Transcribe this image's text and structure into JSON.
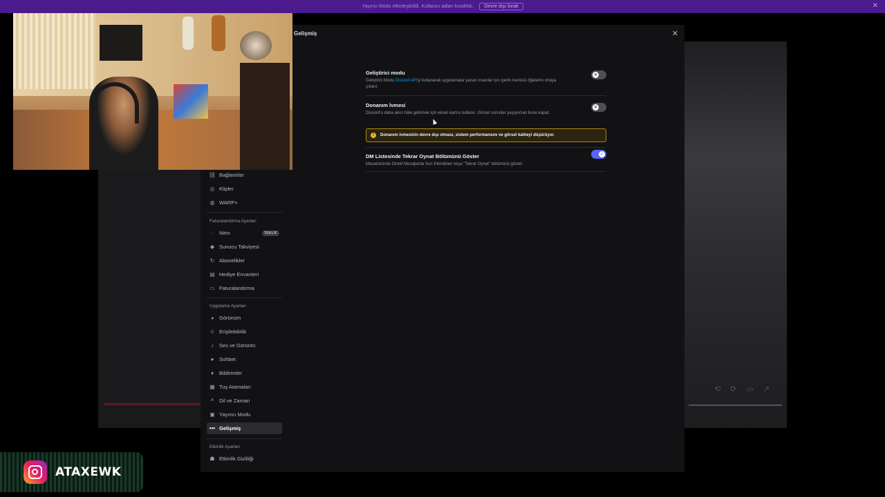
{
  "banner": {
    "text": "Yayıncı Modu etkinleştirildi. Kullanıcı adları kısaltıldı.",
    "button": "Devre dışı bırak"
  },
  "modal": {
    "title": "Gelişmiş"
  },
  "sidebar": {
    "items_top": [
      {
        "label": "Bağlantılar",
        "icon": "link-icon"
      },
      {
        "label": "Klipler",
        "icon": "clip-icon"
      },
      {
        "label": "WARP+",
        "icon": "globe-icon"
      }
    ],
    "billing_header": "Faturalandırma Ayarları",
    "billing_items": [
      {
        "label": "Nitro",
        "icon": "nitro-icon",
        "badge": "TEKLİF"
      },
      {
        "label": "Sunucu Takviyesi",
        "icon": "boost-icon"
      },
      {
        "label": "Abonelikler",
        "icon": "subscription-icon"
      },
      {
        "label": "Hediye Envanteri",
        "icon": "gift-icon"
      },
      {
        "label": "Faturalandırma",
        "icon": "card-icon"
      }
    ],
    "app_header": "Uygulama Ayarları",
    "app_items": [
      {
        "label": "Görünüm",
        "icon": "palette-icon"
      },
      {
        "label": "Erişilebilirlik",
        "icon": "accessibility-icon"
      },
      {
        "label": "Ses ve Görüntü",
        "icon": "mic-icon"
      },
      {
        "label": "Sohbet",
        "icon": "chat-icon"
      },
      {
        "label": "Bildirimler",
        "icon": "bell-icon"
      },
      {
        "label": "Tuş Atamaları",
        "icon": "keyboard-icon"
      },
      {
        "label": "Dil ve Zaman",
        "icon": "language-icon"
      },
      {
        "label": "Yayıncı Modu",
        "icon": "stream-icon"
      },
      {
        "label": "Gelişmiş",
        "icon": "more-icon",
        "active": true
      }
    ],
    "activity_header": "Etkinlik Ayarları",
    "activity_items": [
      {
        "label": "Etkinlik Gizliliği",
        "icon": "privacy-icon"
      }
    ]
  },
  "settings": {
    "dev_mode": {
      "title": "Geliştirici modu",
      "desc_pre": "Geliştirici Modu ",
      "desc_link": "Discord API",
      "desc_post": "'yi kullanarak uygulamalar yazan insanlar için içerik menüsü öğelerini ortaya çıkarır.",
      "enabled": false
    },
    "hw_accel": {
      "title": "Donanım İvmesi",
      "desc": "Discord'u daha akıcı hâle getirmek için ekran kartını kullanır. Görsel sorunlar yaşıyorsan bunu kapat.",
      "enabled": false,
      "warning": "Donanım ivmesinin devre dışı olması, sistem performansını ve görsel kaliteyi düşürüyor."
    },
    "dm_replay": {
      "title": "DM Listesinde Tekrar Oynat Bölümünü Göster",
      "desc": "Masaüstünde Direkt Mesajlarda Son Etkinlikleri veya \"Tekrar Oynat\" bölümünü göster.",
      "enabled": true
    }
  },
  "overlay": {
    "instagram_handle": "ATAXEWK"
  }
}
